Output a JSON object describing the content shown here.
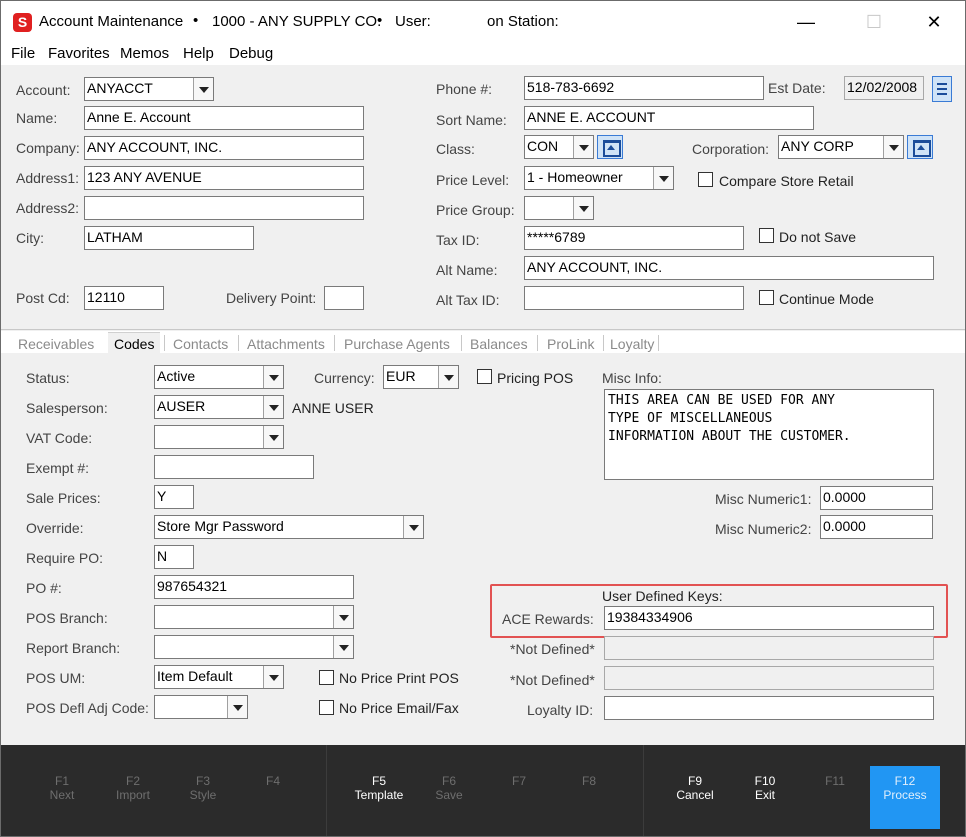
{
  "window": {
    "title_app": "Account Maintenance",
    "title_company": "1000 - ANY SUPPLY CO.",
    "title_user_label": "User:",
    "title_station_label": "on Station:",
    "title_bullet": "•",
    "minimize_glyph": "—",
    "maximize_glyph": "☐",
    "close_glyph": "✕",
    "app_icon_letter": "S",
    "app_icon_color": "#e02020"
  },
  "menu": [
    "File",
    "Favorites",
    "Memos",
    "Help",
    "Debug"
  ],
  "header": {
    "account_label": "Account:",
    "account_value": "ANYACCT",
    "name_label": "Name:",
    "name_value": "Anne E. Account",
    "company_label": "Company:",
    "company_value": "ANY ACCOUNT, INC.",
    "address1_label": "Address1:",
    "address1_value": "123 ANY AVENUE",
    "address2_label": "Address2:",
    "address2_value": "",
    "city_label": "City:",
    "city_value": "LATHAM",
    "postcd_label": "Post Cd:",
    "postcd_value": "12110",
    "delivery_label": "Delivery Point:",
    "delivery_value": "",
    "phone_label": "Phone #:",
    "phone_value": "518-783-6692",
    "estdate_label": "Est Date:",
    "estdate_value": "12/02/2008",
    "sortname_label": "Sort Name:",
    "sortname_value": "ANNE E. ACCOUNT",
    "class_label": "Class:",
    "class_value": "CON",
    "corporation_label": "Corporation:",
    "corporation_value": "ANY CORP",
    "pricelevel_label": "Price Level:",
    "pricelevel_value": "1 - Homeowner",
    "compare_label": "Compare Store Retail",
    "pricegroup_label": "Price Group:",
    "pricegroup_value": "",
    "taxid_label": "Tax ID:",
    "taxid_value": "*****6789",
    "donotsave_label": "Do not Save",
    "altname_label": "Alt  Name:",
    "altname_value": "ANY ACCOUNT, INC.",
    "alttaxid_label": "Alt Tax ID:",
    "alttaxid_value": "",
    "continue_label": "Continue Mode"
  },
  "tabs": [
    "Receivables",
    "Codes",
    "Contacts",
    "Attachments",
    "Purchase Agents",
    "Balances",
    "ProLink",
    "Loyalty"
  ],
  "codes": {
    "status_label": "Status:",
    "status_value": "Active",
    "currency_label": "Currency:",
    "currency_value": "EUR",
    "pricingpos_label": "Pricing POS",
    "miscinfo_label": "Misc Info:",
    "miscinfo_value": "THIS AREA CAN BE USED FOR ANY\nTYPE OF MISCELLANEOUS\nINFORMATION ABOUT THE CUSTOMER.",
    "salesperson_label": "Salesperson:",
    "salesperson_value": "AUSER",
    "salesperson_name": "ANNE USER",
    "vat_label": "VAT Code:",
    "vat_value": "",
    "exempt_label": "Exempt #:",
    "exempt_value": "",
    "saleprices_label": "Sale Prices:",
    "saleprices_value": "Y",
    "override_label": "Override:",
    "override_value": "Store Mgr Password",
    "reqpo_label": "Require PO:",
    "reqpo_value": "N",
    "po_label": "PO #:",
    "po_value": "987654321",
    "posbranch_label": "POS Branch:",
    "posbranch_value": "",
    "reportbranch_label": "Report Branch:",
    "reportbranch_value": "",
    "posum_label": "POS UM:",
    "posum_value": "Item Default",
    "noprice_label": "No Price Print POS",
    "posdefl_label": "POS Defl Adj Code:",
    "posdefl_value": "",
    "nopriceemail_label": "No Price Email/Fax",
    "miscnum1_label": "Misc Numeric1:",
    "miscnum1_value": "0.0000",
    "miscnum2_label": "Misc Numeric2:",
    "miscnum2_value": "0.0000",
    "udk_title": "User Defined Keys:",
    "ace_label": "ACE Rewards:",
    "ace_value": "19384334906",
    "notdef1_label": "*Not Defined*",
    "notdef2_label": "*Not Defined*",
    "loyalty_label": "Loyalty ID:",
    "loyalty_value": ""
  },
  "footer": {
    "keys": [
      {
        "key": "F1",
        "label": "Next"
      },
      {
        "key": "F2",
        "label": "Import"
      },
      {
        "key": "F3",
        "label": "Style"
      },
      {
        "key": "F4",
        "label": ""
      },
      {
        "key": "F5",
        "label": "Template"
      },
      {
        "key": "F6",
        "label": "Save"
      },
      {
        "key": "F7",
        "label": ""
      },
      {
        "key": "F8",
        "label": ""
      },
      {
        "key": "F9",
        "label": "Cancel"
      },
      {
        "key": "F10",
        "label": "Exit"
      },
      {
        "key": "F11",
        "label": ""
      },
      {
        "key": "F12",
        "label": "Process"
      }
    ],
    "primary_color": "#2196f3"
  }
}
